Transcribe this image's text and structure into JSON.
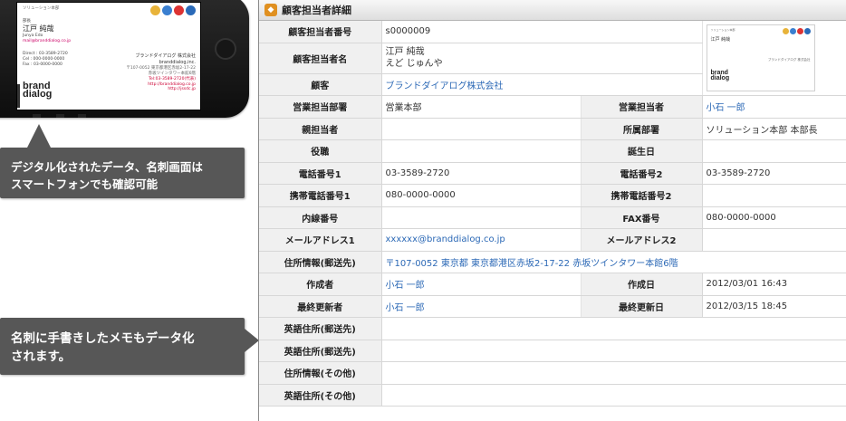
{
  "phone_card": {
    "department": "ソリューション本部",
    "title": "部長",
    "name_ja": "江戸 純哉",
    "name_en": "Junya Edo",
    "email": "mail@branddialog.co.jp",
    "contact_direct": "Direct : 03-3589-2720",
    "contact_cel": "Cel : 000-0000-0000",
    "contact_fax": "Fax : 03-0000-0000",
    "company_ja": "ブランドダイアログ 株式会社",
    "company_en": "branddialog,inc.",
    "address_1": "〒107-0052 東京都港区赤坂2-17-22",
    "address_2": "赤坂ツインタワー本館6階",
    "address_3": "Tel:03-3589-2720(代表)",
    "address_4": "http://branddialog.co.jp",
    "address_5": "http://jssdc.jp",
    "brand_1": "brand",
    "brand_2": "dialog"
  },
  "callouts": {
    "digital_line1": "デジタル化されたデータ、名刺画面は",
    "digital_line2": "スマートフォンでも確認可能",
    "memo_line1": "名刺に手書きしたメモもデータ化",
    "memo_line2": "されます。"
  },
  "panel": {
    "title": "顧客担当者詳細",
    "icon": "contact-card-icon"
  },
  "rows": {
    "r1": {
      "label": "顧客担当者番号",
      "value": "s0000009"
    },
    "r2": {
      "label": "顧客担当者名",
      "value_line1": "江戸 純哉",
      "value_line2": "えど じゅんや"
    },
    "r3": {
      "label": "顧客",
      "value": "ブランドダイアログ株式会社"
    },
    "r4": {
      "label": "営業担当部署",
      "value": "営業本部",
      "label2": "営業担当者",
      "value2": "小石 一郎"
    },
    "r5": {
      "label": "親担当者",
      "value": "",
      "label2": "所属部署",
      "value2": "ソリューション本部 本部長"
    },
    "r6": {
      "label": "役職",
      "value": "",
      "label2": "誕生日",
      "value2": ""
    },
    "r7": {
      "label": "電話番号1",
      "value": "03-3589-2720",
      "label2": "電話番号2",
      "value2": "03-3589-2720"
    },
    "r8": {
      "label": "携帯電話番号1",
      "value": "080-0000-0000",
      "label2": "携帯電話番号2",
      "value2": ""
    },
    "r9": {
      "label": "内線番号",
      "value": "",
      "label2": "FAX番号",
      "value2": "080-0000-0000"
    },
    "r10": {
      "label": "メールアドレス1",
      "value": "xxxxxx@branddialog.co.jp",
      "label2": "メールアドレス2",
      "value2": ""
    },
    "r11": {
      "label": "住所情報(郵送先)",
      "value": "〒107-0052 東京都 東京都港区赤坂2-17-22 赤坂ツインタワー本館6階"
    },
    "r12": {
      "label": "作成者",
      "value": "小石 一郎",
      "label2": "作成日",
      "value2": "2012/03/01 16:43"
    },
    "r13": {
      "label": "最終更新者",
      "value": "小石 一郎",
      "label2": "最終更新日",
      "value2": "2012/03/15 18:45"
    },
    "r14": {
      "label": "英語住所(郵送先)",
      "value": ""
    },
    "r15": {
      "label": "英語住所(郵送先)",
      "value": ""
    },
    "r16": {
      "label": "住所情報(その他)",
      "value": ""
    },
    "r17": {
      "label": "英語住所(その他)",
      "value": ""
    }
  },
  "colors": {
    "link": "#2c69b6",
    "callout_bg": "#575757",
    "label_bg": "#f0f0f0"
  }
}
